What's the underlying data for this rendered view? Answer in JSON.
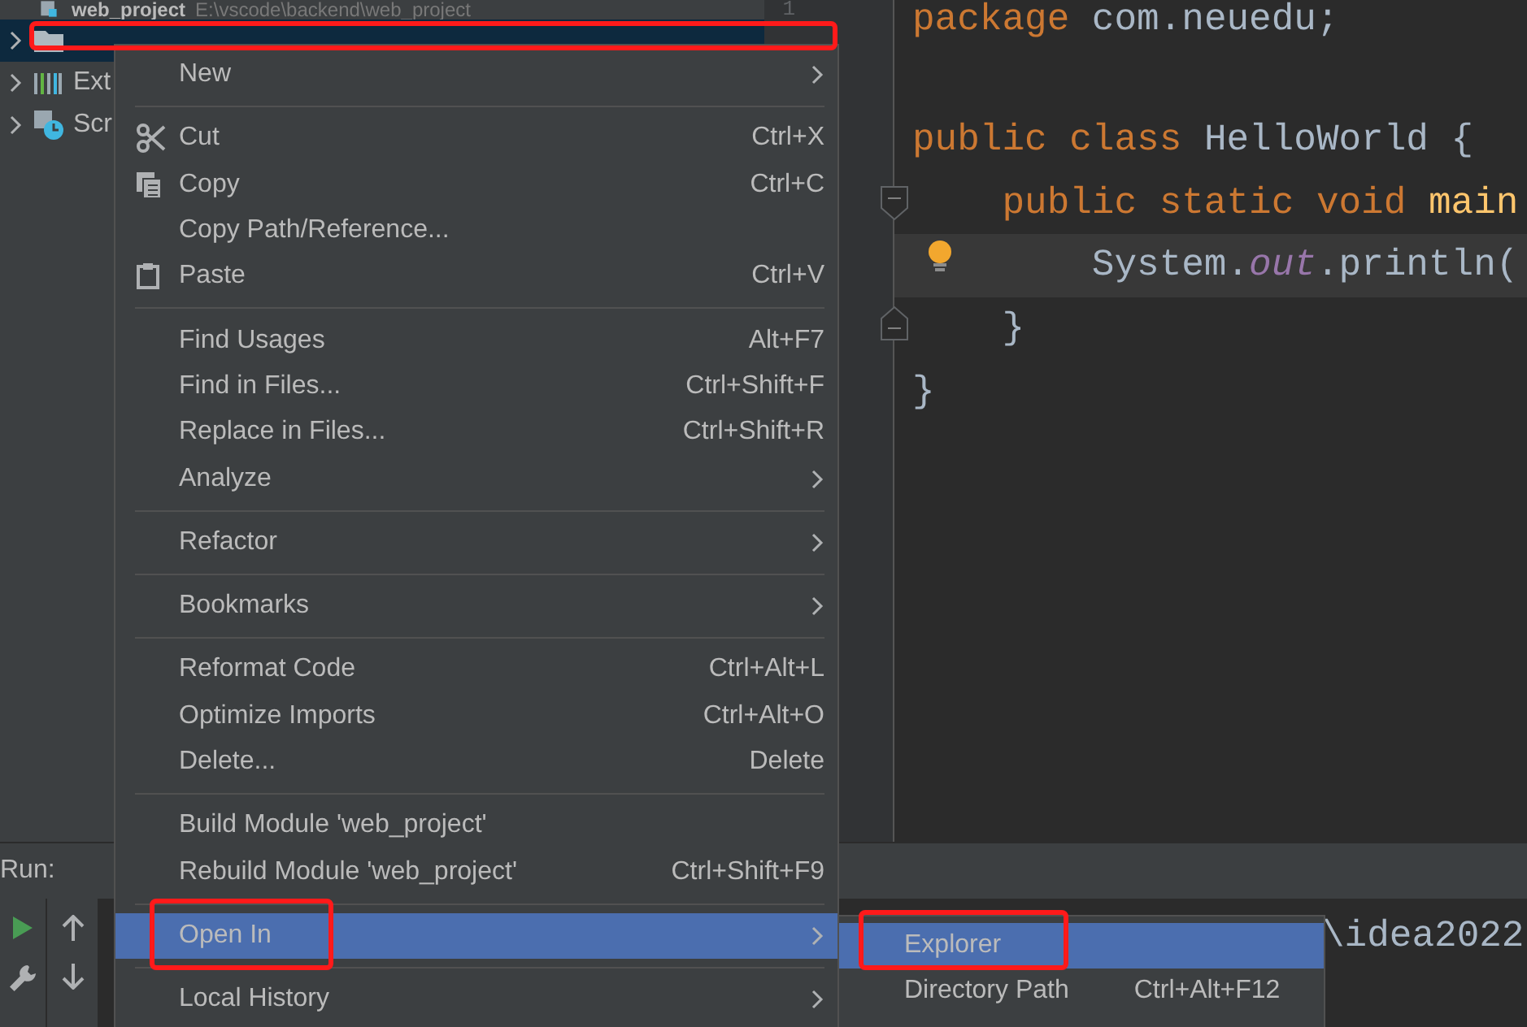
{
  "project_tree": {
    "rows": [
      {
        "kind": "module",
        "name": "web_project",
        "path": "E:\\vscode\\backend\\web_project",
        "selected": false,
        "annotated": false,
        "has_chevron": false
      },
      {
        "kind": "folder",
        "selected": true,
        "annotated": true,
        "has_chevron": true
      },
      {
        "kind": "library",
        "name": "Ext",
        "selected": false,
        "annotated": false,
        "has_chevron": true
      },
      {
        "kind": "scratch",
        "name": "Scr",
        "selected": false,
        "annotated": false,
        "has_chevron": true
      }
    ]
  },
  "editor": {
    "line_numbers": [
      "1"
    ],
    "lines": [
      {
        "kind": "code",
        "current": false,
        "tokens": [
          {
            "kind": "keyword",
            "text": "package"
          },
          {
            "kind": "plain",
            "text": " com.neuedu;"
          }
        ]
      },
      {
        "kind": "blank"
      },
      {
        "kind": "code",
        "current": false,
        "tokens": [
          {
            "kind": "keyword",
            "text": "public class"
          },
          {
            "kind": "plain",
            "text": " HelloWorld {"
          }
        ]
      },
      {
        "kind": "code",
        "current": false,
        "tokens": [
          {
            "kind": "keyword",
            "text": "    public static void"
          },
          {
            "kind": "method",
            "text": " main"
          }
        ]
      },
      {
        "kind": "code",
        "current": true,
        "tokens": [
          {
            "kind": "plain",
            "text": "        System."
          },
          {
            "kind": "field",
            "text": "out"
          },
          {
            "kind": "plain",
            "text": ".println("
          }
        ]
      },
      {
        "kind": "code",
        "current": false,
        "tokens": [
          {
            "kind": "plain",
            "text": "    }"
          }
        ]
      },
      {
        "kind": "code",
        "current": false,
        "tokens": [
          {
            "kind": "plain",
            "text": "}"
          }
        ]
      }
    ]
  },
  "run_panel": {
    "title": "Run:",
    "console_text": "\\idea2022"
  },
  "context_menu": {
    "items": [
      {
        "kind": "item",
        "label": "New",
        "submenu": true,
        "selected": false,
        "annotated": false
      },
      {
        "kind": "separator"
      },
      {
        "kind": "cut",
        "label": "Cut",
        "shortcut": "Ctrl+X",
        "submenu": false,
        "selected": false,
        "annotated": false
      },
      {
        "kind": "copy",
        "label": "Copy",
        "shortcut": "Ctrl+C",
        "submenu": false,
        "selected": false,
        "annotated": false
      },
      {
        "kind": "item",
        "label": "Copy Path/Reference...",
        "submenu": false,
        "selected": false,
        "annotated": false
      },
      {
        "kind": "paste",
        "label": "Paste",
        "shortcut": "Ctrl+V",
        "submenu": false,
        "selected": false,
        "annotated": false
      },
      {
        "kind": "separator"
      },
      {
        "kind": "item",
        "label": "Find Usages",
        "shortcut": "Alt+F7",
        "submenu": false,
        "selected": false,
        "annotated": false
      },
      {
        "kind": "item",
        "label": "Find in Files...",
        "shortcut": "Ctrl+Shift+F",
        "submenu": false,
        "selected": false,
        "annotated": false
      },
      {
        "kind": "item",
        "label": "Replace in Files...",
        "shortcut": "Ctrl+Shift+R",
        "submenu": false,
        "selected": false,
        "annotated": false
      },
      {
        "kind": "item",
        "label": "Analyze",
        "submenu": true,
        "selected": false,
        "annotated": false
      },
      {
        "kind": "separator"
      },
      {
        "kind": "item",
        "label": "Refactor",
        "submenu": true,
        "selected": false,
        "annotated": false
      },
      {
        "kind": "separator"
      },
      {
        "kind": "item",
        "label": "Bookmarks",
        "submenu": true,
        "selected": false,
        "annotated": false
      },
      {
        "kind": "separator"
      },
      {
        "kind": "item",
        "label": "Reformat Code",
        "shortcut": "Ctrl+Alt+L",
        "submenu": false,
        "selected": false,
        "annotated": false
      },
      {
        "kind": "item",
        "label": "Optimize Imports",
        "shortcut": "Ctrl+Alt+O",
        "submenu": false,
        "selected": false,
        "annotated": false
      },
      {
        "kind": "item",
        "label": "Delete...",
        "shortcut": "Delete",
        "submenu": false,
        "selected": false,
        "annotated": false
      },
      {
        "kind": "separator"
      },
      {
        "kind": "item",
        "label": "Build Module 'web_project'",
        "submenu": false,
        "selected": false,
        "annotated": false
      },
      {
        "kind": "item",
        "label": "Rebuild Module 'web_project'",
        "shortcut": "Ctrl+Shift+F9",
        "submenu": false,
        "selected": false,
        "annotated": false
      },
      {
        "kind": "separator"
      },
      {
        "kind": "item",
        "label": "Open In",
        "submenu": true,
        "selected": true,
        "annotated": true
      },
      {
        "kind": "separator"
      },
      {
        "kind": "item",
        "label": "Local History",
        "submenu": true,
        "selected": false,
        "annotated": false
      }
    ]
  },
  "submenu": {
    "items": [
      {
        "label": "Explorer",
        "selected": true,
        "annotated": true
      },
      {
        "label": "Directory Path",
        "shortcut": "Ctrl+Alt+F12",
        "selected": false,
        "annotated": false
      }
    ]
  }
}
